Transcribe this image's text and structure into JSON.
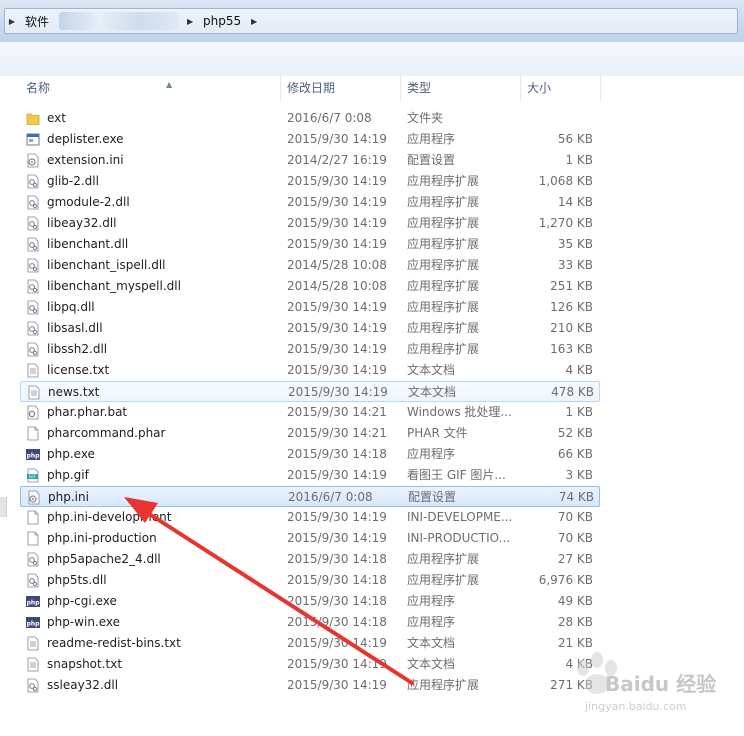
{
  "address": {
    "crumbs": [
      "软件",
      "php55"
    ]
  },
  "columns": {
    "name": "名称",
    "date": "修改日期",
    "type": "类型",
    "size": "大小"
  },
  "files": [
    {
      "name": "ext",
      "date": "2016/6/7 0:08",
      "type": "文件夹",
      "size": "",
      "icon": "folder-icon"
    },
    {
      "name": "deplister.exe",
      "date": "2015/9/30 14:19",
      "type": "应用程序",
      "size": "56 KB",
      "icon": "exe-icon"
    },
    {
      "name": "extension.ini",
      "date": "2014/2/27 16:19",
      "type": "配置设置",
      "size": "1 KB",
      "icon": "ini-icon"
    },
    {
      "name": "glib-2.dll",
      "date": "2015/9/30 14:19",
      "type": "应用程序扩展",
      "size": "1,068 KB",
      "icon": "dll-icon"
    },
    {
      "name": "gmodule-2.dll",
      "date": "2015/9/30 14:19",
      "type": "应用程序扩展",
      "size": "14 KB",
      "icon": "dll-icon"
    },
    {
      "name": "libeay32.dll",
      "date": "2015/9/30 14:19",
      "type": "应用程序扩展",
      "size": "1,270 KB",
      "icon": "dll-icon"
    },
    {
      "name": "libenchant.dll",
      "date": "2015/9/30 14:19",
      "type": "应用程序扩展",
      "size": "35 KB",
      "icon": "dll-icon"
    },
    {
      "name": "libenchant_ispell.dll",
      "date": "2014/5/28 10:08",
      "type": "应用程序扩展",
      "size": "33 KB",
      "icon": "dll-icon"
    },
    {
      "name": "libenchant_myspell.dll",
      "date": "2014/5/28 10:08",
      "type": "应用程序扩展",
      "size": "251 KB",
      "icon": "dll-icon"
    },
    {
      "name": "libpq.dll",
      "date": "2015/9/30 14:19",
      "type": "应用程序扩展",
      "size": "126 KB",
      "icon": "dll-icon"
    },
    {
      "name": "libsasl.dll",
      "date": "2015/9/30 14:19",
      "type": "应用程序扩展",
      "size": "210 KB",
      "icon": "dll-icon"
    },
    {
      "name": "libssh2.dll",
      "date": "2015/9/30 14:19",
      "type": "应用程序扩展",
      "size": "163 KB",
      "icon": "dll-icon"
    },
    {
      "name": "license.txt",
      "date": "2015/9/30 14:19",
      "type": "文本文档",
      "size": "4 KB",
      "icon": "txt-icon"
    },
    {
      "name": "news.txt",
      "date": "2015/9/30 14:19",
      "type": "文本文档",
      "size": "478 KB",
      "icon": "txt-icon",
      "state": "hov"
    },
    {
      "name": "phar.phar.bat",
      "date": "2015/9/30 14:21",
      "type": "Windows 批处理...",
      "size": "1 KB",
      "icon": "bat-icon"
    },
    {
      "name": "pharcommand.phar",
      "date": "2015/9/30 14:21",
      "type": "PHAR 文件",
      "size": "52 KB",
      "icon": "file-icon"
    },
    {
      "name": "php.exe",
      "date": "2015/9/30 14:18",
      "type": "应用程序",
      "size": "66 KB",
      "icon": "php-exe-icon"
    },
    {
      "name": "php.gif",
      "date": "2015/9/30 14:19",
      "type": "看图王 GIF 图片...",
      "size": "3 KB",
      "icon": "gif-icon"
    },
    {
      "name": "php.ini",
      "date": "2016/6/7 0:08",
      "type": "配置设置",
      "size": "74 KB",
      "icon": "ini-icon",
      "state": "sel"
    },
    {
      "name": "php.ini-development",
      "date": "2015/9/30 14:19",
      "type": "INI-DEVELOPME...",
      "size": "70 KB",
      "icon": "file-icon"
    },
    {
      "name": "php.ini-production",
      "date": "2015/9/30 14:19",
      "type": "INI-PRODUCTIO...",
      "size": "70 KB",
      "icon": "file-icon"
    },
    {
      "name": "php5apache2_4.dll",
      "date": "2015/9/30 14:18",
      "type": "应用程序扩展",
      "size": "27 KB",
      "icon": "dll-icon"
    },
    {
      "name": "php5ts.dll",
      "date": "2015/9/30 14:18",
      "type": "应用程序扩展",
      "size": "6,976 KB",
      "icon": "dll-icon"
    },
    {
      "name": "php-cgi.exe",
      "date": "2015/9/30 14:18",
      "type": "应用程序",
      "size": "49 KB",
      "icon": "php-exe-icon"
    },
    {
      "name": "php-win.exe",
      "date": "2015/9/30 14:18",
      "type": "应用程序",
      "size": "28 KB",
      "icon": "php-exe-icon"
    },
    {
      "name": "readme-redist-bins.txt",
      "date": "2015/9/30 14:19",
      "type": "文本文档",
      "size": "21 KB",
      "icon": "txt-icon"
    },
    {
      "name": "snapshot.txt",
      "date": "2015/9/30 14:19",
      "type": "文本文档",
      "size": "4 KB",
      "icon": "txt-icon"
    },
    {
      "name": "ssleay32.dll",
      "date": "2015/9/30 14:19",
      "type": "应用程序扩展",
      "size": "271 KB",
      "icon": "dll-icon"
    }
  ],
  "watermark": {
    "text": "Baidu 经验",
    "sub": "jingyan.baidu.com"
  },
  "colors": {
    "selection": "#cce4fb",
    "arrow": "#e8342f"
  }
}
